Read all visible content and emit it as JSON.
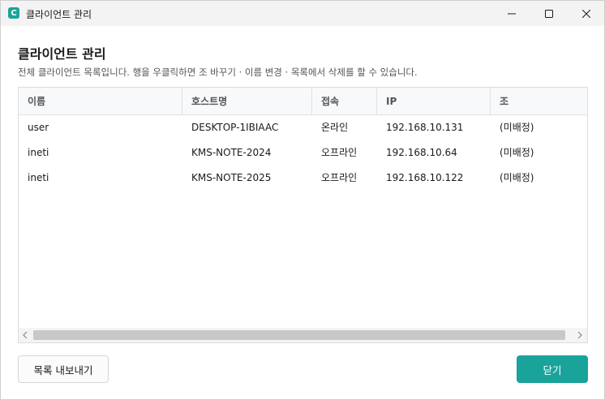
{
  "window": {
    "title": "클라이언트 관리",
    "app_icon_letter": "C"
  },
  "page": {
    "heading": "클라이언트 관리",
    "description": "전체 클라이언트 목록입니다. 행을 우클릭하면 조 바꾸기 · 이름 변경 · 목록에서 삭제를 할 수 있습니다."
  },
  "table": {
    "columns": [
      "이름",
      "호스트명",
      "접속",
      "IP",
      "조"
    ],
    "rows": [
      {
        "name": "user",
        "hostname": "DESKTOP-1IBIAAC",
        "status": "온라인",
        "ip": "192.168.10.131",
        "group": "(미배정)"
      },
      {
        "name": "ineti",
        "hostname": "KMS-NOTE-2024",
        "status": "오프라인",
        "ip": "192.168.10.64",
        "group": "(미배정)"
      },
      {
        "name": "ineti",
        "hostname": "KMS-NOTE-2025",
        "status": "오프라인",
        "ip": "192.168.10.122",
        "group": "(미배정)"
      }
    ]
  },
  "buttons": {
    "export_label": "목록 내보내기",
    "close_label": "닫기"
  },
  "colors": {
    "accent": "#1aa39a"
  },
  "icons": {
    "minimize": "minimize-icon",
    "maximize": "maximize-icon",
    "close": "close-icon",
    "scroll_left": "chevron-left-icon",
    "scroll_right": "chevron-right-icon"
  }
}
